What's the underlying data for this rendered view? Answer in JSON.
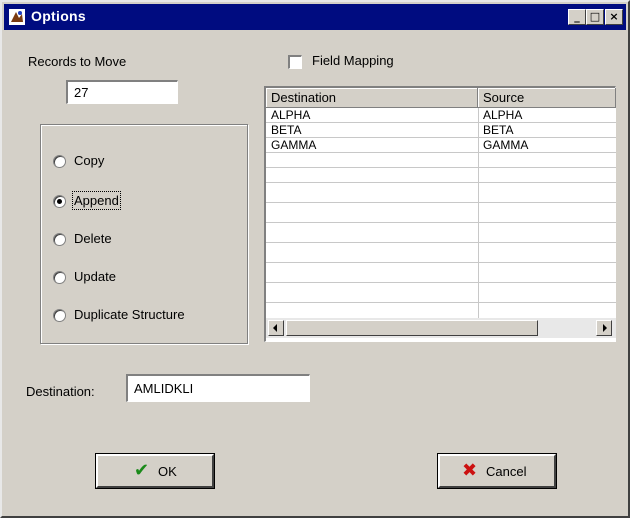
{
  "window": {
    "title": "Options",
    "controls": {
      "minimize": "_",
      "maximize": "□",
      "close": "×"
    }
  },
  "records": {
    "label": "Records to Move",
    "value": "27"
  },
  "mode": {
    "options": [
      "Copy",
      "Append",
      "Delete",
      "Update",
      "Duplicate Structure"
    ],
    "selected": "Append"
  },
  "field_mapping": {
    "label": "Field Mapping",
    "checked": false
  },
  "grid": {
    "columns": [
      "Destination",
      "Source"
    ],
    "rows": [
      [
        "ALPHA",
        "ALPHA"
      ],
      [
        "BETA",
        "BETA"
      ],
      [
        "GAMMA",
        "GAMMA"
      ]
    ]
  },
  "destination": {
    "label": "Destination:",
    "value": "AMLIDKLI"
  },
  "buttons": {
    "ok": "OK",
    "cancel": "Cancel"
  },
  "colors": {
    "titlebar": "#000c80",
    "ok_check": "#1a8a1a",
    "cancel_x": "#cc1111"
  }
}
